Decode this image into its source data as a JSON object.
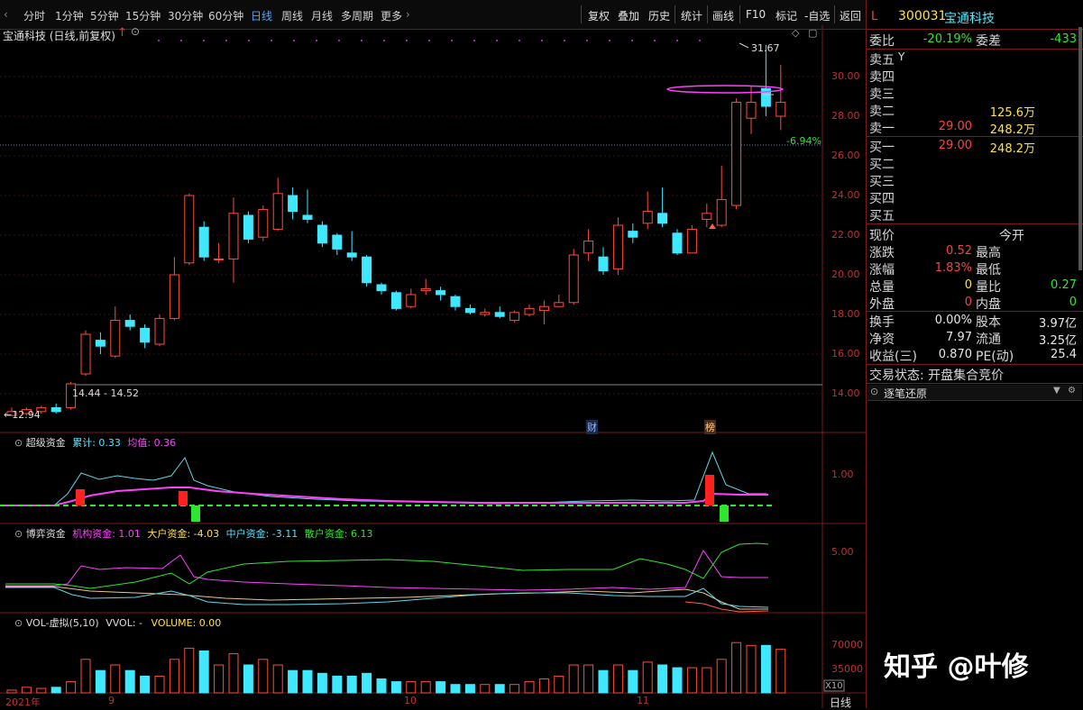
{
  "toolbar": {
    "periods": [
      "分时",
      "1分钟",
      "5分钟",
      "15分钟",
      "30分钟",
      "60分钟",
      "日线",
      "周线",
      "月线",
      "多周期",
      "更多"
    ],
    "active": "日线",
    "right_buttons": [
      "复权",
      "叠加",
      "历史",
      "统计",
      "画线",
      "F10",
      "标记",
      "-自选",
      "返回"
    ]
  },
  "chart": {
    "stock_title": "宝通科技 (日线,前复权)",
    "price_ticks": [
      "30.00",
      "28.00",
      "26.00",
      "24.00",
      "22.00",
      "20.00",
      "18.00",
      "16.00",
      "14.00"
    ],
    "high_label": "31.67",
    "low_label": "12.94",
    "range_label": "14.44 - 14.52",
    "pct_label": "-6.94%",
    "markers": [
      "财",
      "榜"
    ],
    "indicator1": {
      "name": "超级资金",
      "cum_label": "累计: 0.33",
      "avg_label": "均值: 0.36",
      "tick": "1.00"
    },
    "indicator2": {
      "name": "博弈资金",
      "inst": "机构资金: 1.01",
      "big": "大户资金: -4.03",
      "mid": "中户资金: -3.11",
      "retail": "散户资金: 6.13",
      "tick": "5.00"
    },
    "indicator3": {
      "name": "VOL-虚拟(5,10)",
      "vvol": "VVOL: -",
      "volume": "VOLUME: 0.00",
      "tick_hi": "70000",
      "tick_lo": "35000",
      "x10": "X10"
    },
    "dates": [
      "2021年",
      "9",
      "10",
      "11"
    ],
    "bottom_period": "日线"
  },
  "quote": {
    "flag": "L",
    "code": "300031",
    "name": "宝通科技",
    "weibi_label": "委比",
    "weibi": "-20.19%",
    "weicha_label": "委差",
    "weicha": "-433",
    "sell": [
      {
        "label": "卖五",
        "price": "",
        "vol": "",
        "suffix": "Y"
      },
      {
        "label": "卖四",
        "price": "",
        "vol": ""
      },
      {
        "label": "卖三",
        "price": "",
        "vol": ""
      },
      {
        "label": "卖二",
        "price": "",
        "vol": "125.6万"
      },
      {
        "label": "卖一",
        "price": "29.00",
        "vol": "248.2万"
      }
    ],
    "buy": [
      {
        "label": "买一",
        "price": "29.00",
        "vol": "248.2万"
      },
      {
        "label": "买二",
        "price": "",
        "vol": ""
      },
      {
        "label": "买三",
        "price": "",
        "vol": ""
      },
      {
        "label": "买四",
        "price": "",
        "vol": ""
      },
      {
        "label": "买五",
        "price": "",
        "vol": ""
      }
    ],
    "stats": [
      {
        "l1": "现价",
        "v1": "",
        "l2": "今开",
        "v2": ""
      },
      {
        "l1": "涨跌",
        "v1": "0.52",
        "l2": "最高",
        "v2": ""
      },
      {
        "l1": "涨幅",
        "v1": "1.83%",
        "l2": "最低",
        "v2": ""
      },
      {
        "l1": "总量",
        "v1": "0",
        "l2": "量比",
        "v2": "0.27"
      },
      {
        "l1": "外盘",
        "v1": "0",
        "l2": "内盘",
        "v2": "0"
      }
    ],
    "stats2": [
      {
        "l1": "换手",
        "v1": "0.00%",
        "l2": "股本",
        "v2": "3.97亿"
      },
      {
        "l1": "净资",
        "v1": "7.97",
        "l2": "流通",
        "v2": "3.25亿"
      },
      {
        "l1": "收益(三)",
        "v1": "0.870",
        "l2": "PE(动)",
        "v2": "25.4"
      }
    ],
    "trade_status": "交易状态: 开盘集合竞价",
    "tick_title": "逐笔还原"
  },
  "watermark": "知乎 @叶修"
}
